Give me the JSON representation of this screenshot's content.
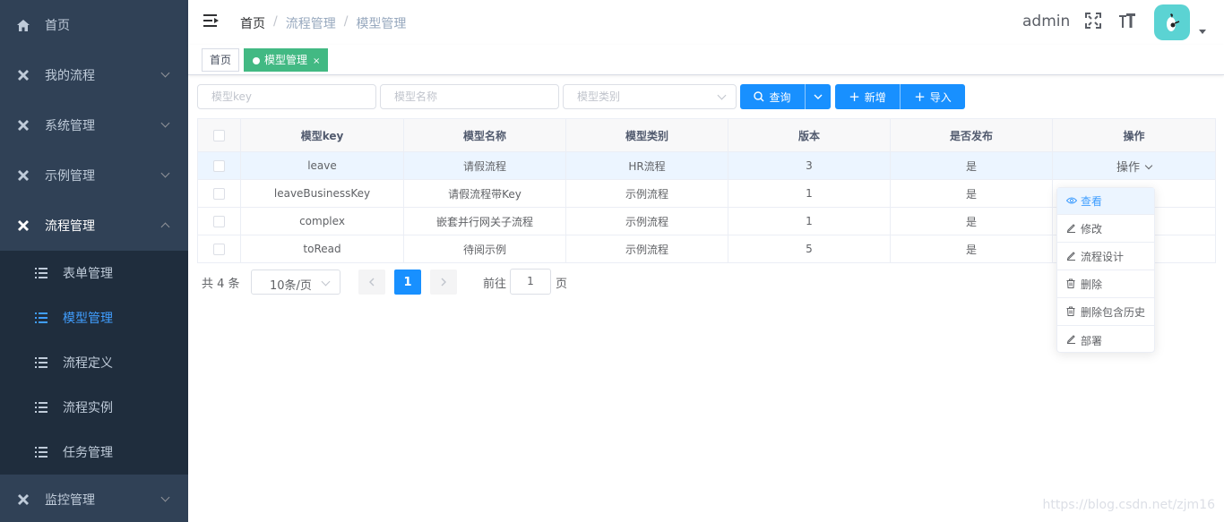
{
  "sidebar": {
    "items": [
      {
        "label": "首页",
        "icon": "home-icon"
      },
      {
        "label": "我的流程",
        "icon": "tools-icon"
      },
      {
        "label": "系统管理",
        "icon": "tools-icon"
      },
      {
        "label": "示例管理",
        "icon": "tools-icon"
      },
      {
        "label": "流程管理",
        "icon": "tools-icon"
      },
      {
        "label": "监控管理",
        "icon": "tools-icon"
      }
    ],
    "submenu": [
      {
        "label": "表单管理"
      },
      {
        "label": "模型管理"
      },
      {
        "label": "流程定义"
      },
      {
        "label": "流程实例"
      },
      {
        "label": "任务管理"
      }
    ],
    "active_color": "#409eff",
    "bg_color": "#304156"
  },
  "navbar": {
    "breadcrumb": [
      "首页",
      "流程管理",
      "模型管理"
    ],
    "username": "admin"
  },
  "tags": [
    {
      "label": "首页"
    },
    {
      "label": "模型管理",
      "close": "×"
    }
  ],
  "filters": {
    "model_key_placeholder": "模型key",
    "model_name_placeholder": "模型名称",
    "model_type_placeholder": "模型类别",
    "search_label": "查询",
    "add_label": "新增",
    "import_label": "导入"
  },
  "table": {
    "headers": [
      "模型key",
      "模型名称",
      "模型类别",
      "版本",
      "是否发布",
      "操作"
    ],
    "rows": [
      {
        "key": "leave",
        "name": "请假流程",
        "type": "HR流程",
        "version": "3",
        "published": "是",
        "op": "操作"
      },
      {
        "key": "leaveBusinessKey",
        "name": "请假流程带Key",
        "type": "示例流程",
        "version": "1",
        "published": "是"
      },
      {
        "key": "complex",
        "name": "嵌套并行网关子流程",
        "type": "示例流程",
        "version": "1",
        "published": "是"
      },
      {
        "key": "toRead",
        "name": "待阅示例",
        "type": "示例流程",
        "version": "5",
        "published": "是"
      }
    ]
  },
  "dropdown": {
    "items": [
      {
        "label": "查看",
        "icon": "eye-icon"
      },
      {
        "label": "修改",
        "icon": "edit-icon"
      },
      {
        "label": "流程设计",
        "icon": "edit-icon"
      },
      {
        "label": "删除",
        "icon": "trash-icon"
      },
      {
        "label": "删除包含历史",
        "icon": "trash-icon"
      },
      {
        "label": "部署",
        "icon": "edit-icon"
      }
    ]
  },
  "pagination": {
    "total": "共 4 条",
    "page_size": "10条/页",
    "current_page": "1",
    "goto_label": "前往",
    "goto_value": "1",
    "goto_unit": "页"
  },
  "watermark": "https://blog.csdn.net/zjm16"
}
